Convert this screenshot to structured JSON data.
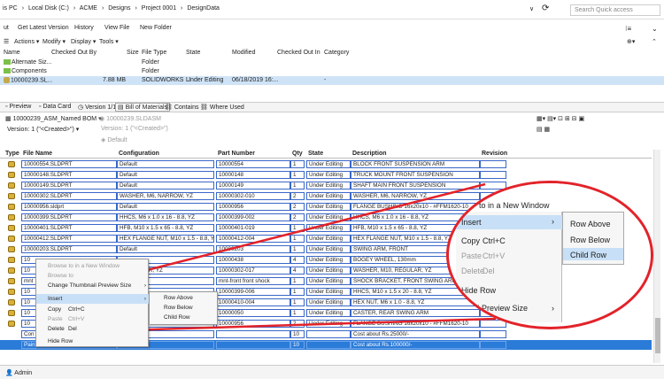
{
  "address": {
    "crumbs": [
      "is PC",
      "›",
      "Local Disk (C:)",
      "›",
      "ACME",
      "›",
      "Designs",
      "›",
      "Project 0001",
      "›",
      "DesignData"
    ],
    "search_placeholder": "Search Quick access"
  },
  "menubar": {
    "items": [
      "ut",
      "Get Latest Version",
      "History",
      "View File",
      "New Folder"
    ]
  },
  "toolbar": {
    "items": [
      "Actions ▾",
      "Modify ▾",
      "Display ▾",
      "Tools ▾"
    ]
  },
  "filelist": {
    "headers": [
      "Name",
      "Checked Out By",
      "Size",
      "File Type",
      "State",
      "Modified",
      "Checked Out In",
      "Category"
    ],
    "rows": [
      {
        "name": "Alternate Siz...",
        "checked_out_by": "",
        "size": "",
        "type": "Folder",
        "state": "",
        "modified": "",
        "checked_out_in": "",
        "category": ""
      },
      {
        "name": "Components",
        "checked_out_by": "",
        "size": "",
        "type": "Folder",
        "state": "",
        "modified": "",
        "checked_out_in": "",
        "category": ""
      },
      {
        "name": "10000239.SL...",
        "checked_out_by": "",
        "size": "7.88 MB",
        "type": "SOLIDWORKS ...",
        "state": "Under Editing",
        "modified": "06/18/2019 16:...",
        "checked_out_in": "",
        "category": "-"
      }
    ]
  },
  "tabs": [
    "Preview",
    "Data Card",
    "Version 1/1",
    "Bill of Materials",
    "Contains",
    "Where Used"
  ],
  "bom": {
    "name": "10000239_ASM_Named BOM",
    "file": "10000239.SLDASM",
    "version_left": "Version: 1 (\"<Created>\")",
    "version_right": "Version: 1 (\"<Created>\")",
    "config": "Default"
  },
  "grid": {
    "headers": [
      "Type",
      "File Name",
      "Configuration",
      "Part Number",
      "Qty",
      "State",
      "Description",
      "Revision"
    ],
    "rows": [
      {
        "file": "10000554.SLDPRT",
        "config": "Default",
        "part": "10000554",
        "qty": "1",
        "state": "Under Editing",
        "desc": "BLOCK FRONT SUSPENSION ARM"
      },
      {
        "file": "10000148.SLDPRT",
        "config": "Default",
        "part": "10000148",
        "qty": "1",
        "state": "Under Editing",
        "desc": "TRUCK MOUNT FRONT SUSPENSION"
      },
      {
        "file": "10000149.SLDPRT",
        "config": "Default",
        "part": "10000149",
        "qty": "1",
        "state": "Under Editing",
        "desc": "SHAFT MAIN FRONT SUSPENSION"
      },
      {
        "file": "10000302.SLDPRT",
        "config": "WASHER, M6, NARROW, YZ",
        "part": "10000302-010",
        "qty": "2",
        "state": "Under Editing",
        "desc": "WASHER, M6, NARROW, YZ"
      },
      {
        "file": "10000956.sldprt",
        "config": "Default",
        "part": "10000956",
        "qty": "2",
        "state": "Under Editing",
        "desc": "FLANGE BUSHING 16x20x10 - #FFM1620-10"
      },
      {
        "file": "10000399.SLDPRT",
        "config": "HHCS, M6 x 1.0 x 16 - 8.8, YZ",
        "part": "10000399-002",
        "qty": "2",
        "state": "Under Editing",
        "desc": "HHCS, M6 x 1.0 x 16 - 8.8, YZ"
      },
      {
        "file": "10000401.SLDPRT",
        "config": "HFB, M10 x 1.5 x 65 - 8.8, YZ",
        "part": "10000401-019",
        "qty": "1",
        "state": "Under Editing",
        "desc": "HFB, M10 x 1.5 x 65 - 8.8, YZ"
      },
      {
        "file": "10000412.SLDPRT",
        "config": "HEX FLANGE NUT, M10 x 1.5 - 8.8, YZ",
        "part": "10000412-004",
        "qty": "1",
        "state": "Under Editing",
        "desc": "HEX FLANGE NUT, M10 x 1.5 - 8.8, YZ"
      },
      {
        "file": "10000203.SLDPRT",
        "config": "Default",
        "part": "10000203",
        "qty": "1",
        "state": "Under Editing",
        "desc": "SWING ARM, FRONT"
      },
      {
        "file": "10",
        "config": "",
        "part": "10000438",
        "qty": "4",
        "state": "Under Editing",
        "desc": "BOGEY WHEEL, 130mm"
      },
      {
        "file": "10",
        "config": "2, REGULAR, YZ",
        "part": "10000302-017",
        "qty": "4",
        "state": "Under Editing",
        "desc": "WASHER, M10, REGULAR, YZ"
      },
      {
        "file": "mnt",
        "config": "",
        "part": "mnt-front front shock",
        "qty": "1",
        "state": "Under Editing",
        "desc": "SHOCK BRACKET, FRONT SWING ARM"
      },
      {
        "file": "10",
        "config": "",
        "part": "10000399-006",
        "qty": "1",
        "state": "Under Editing",
        "desc": "HHCS, M10 x 1.5 x 20 - 8.8, YZ"
      },
      {
        "file": "10",
        "config": "",
        "part": "10000410-004",
        "qty": "1",
        "state": "Under Editing",
        "desc": "HEX NUT, M6 x 1.0 - 8.8, YZ"
      },
      {
        "file": "10",
        "config": "",
        "part": "10000050",
        "qty": "1",
        "state": "Under Editing",
        "desc": "CASTER, REAR SWING ARM"
      },
      {
        "file": "10",
        "config": "",
        "part": "10000956",
        "qty": "2",
        "state": "Under Editing",
        "desc": "FLANGE BUSHING 16x20x10 - #FFM1620-10"
      },
      {
        "file": "Con",
        "config": "",
        "part": "",
        "qty": "10",
        "state": "",
        "desc": "Cost about Rs.25000/-"
      },
      {
        "file": "Paint",
        "config": "",
        "part": "",
        "qty": "10",
        "state": "",
        "desc": "Cost about Rs.100000/-"
      }
    ]
  },
  "context_menu": {
    "items": [
      {
        "label": "Browse to in a New Window",
        "shortcut": "",
        "disabled": true
      },
      {
        "label": "Browse to",
        "shortcut": "",
        "disabled": true
      },
      {
        "label": "Change Thumbnail Preview Size",
        "shortcut": "",
        "disabled": false,
        "submenu": true
      },
      {
        "label": "Insert",
        "shortcut": "",
        "disabled": false,
        "submenu": true,
        "highlighted": true
      },
      {
        "label": "Copy",
        "shortcut": "Ctrl+C",
        "disabled": false
      },
      {
        "label": "Paste",
        "shortcut": "Ctrl+V",
        "disabled": true
      },
      {
        "label": "Delete",
        "shortcut": "Del",
        "disabled": false
      },
      {
        "label": "Hide Row",
        "shortcut": "",
        "disabled": false
      }
    ],
    "submenu": [
      "Row Above",
      "Row Below",
      "Child Row"
    ]
  },
  "callout": {
    "top_text": "to in a New Window",
    "menu": [
      {
        "label": "Insert",
        "shortcut": ""
      },
      {
        "label": "Copy",
        "shortcut": "Ctrl+C"
      },
      {
        "label": "Paste",
        "shortcut": "Ctrl+V"
      },
      {
        "label": "Delete",
        "shortcut": "Del"
      },
      {
        "label": "Hide Row",
        "shortcut": ""
      },
      {
        "label": "mbnail Preview Size",
        "shortcut": ""
      }
    ],
    "submenu": [
      "Row Above",
      "Row Below",
      "Child Row"
    ]
  },
  "status": {
    "user": "Admin"
  },
  "colors": {
    "selection": "#2b7bd8",
    "accent_red": "#e2232a",
    "cell_border": "#3a67c8"
  }
}
